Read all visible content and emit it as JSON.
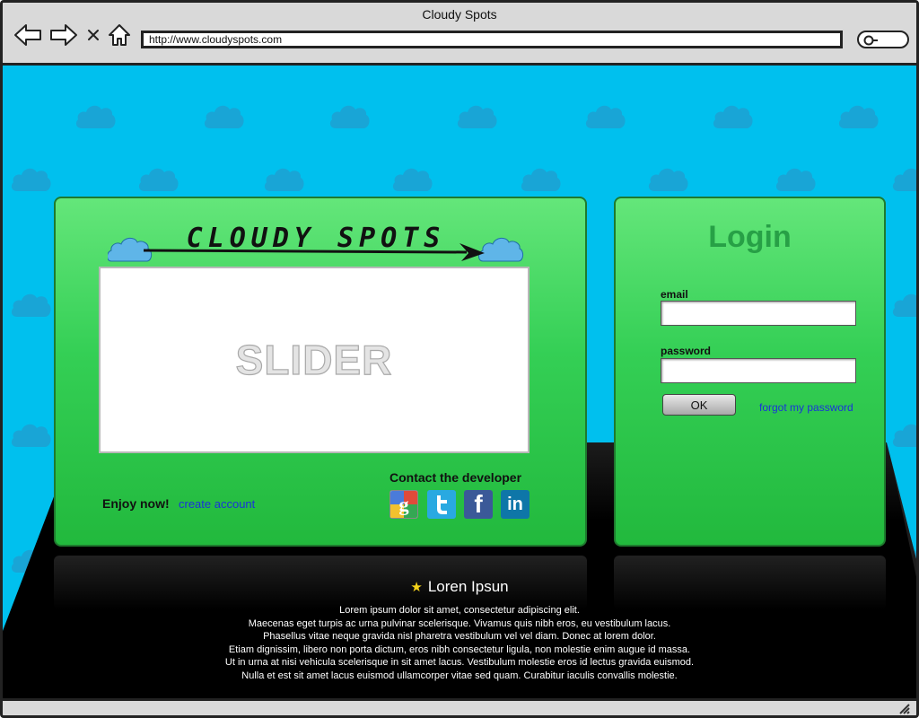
{
  "window": {
    "title": "Cloudy Spots",
    "url": "http://www.cloudyspots.com"
  },
  "icons": {
    "back": "arrow-left-icon",
    "forward": "arrow-right-icon",
    "stop": "close-icon",
    "home": "home-icon",
    "search": "search-icon",
    "resize": "resize-grip-icon"
  },
  "main": {
    "logo_text": "CLOUDY SPOTS",
    "slider_label": "SLIDER",
    "enjoy_text": "Enjoy now!",
    "create_account_link": "create account",
    "contact_title": "Contact the developer",
    "social": [
      {
        "name": "google",
        "icon": "google-icon"
      },
      {
        "name": "twitter",
        "icon": "twitter-icon"
      },
      {
        "name": "facebook",
        "icon": "facebook-icon",
        "glyph": "f"
      },
      {
        "name": "linkedin",
        "icon": "linkedin-icon",
        "glyph": "in"
      }
    ]
  },
  "login": {
    "title": "Login",
    "email_label": "email",
    "email_value": "",
    "password_label": "password",
    "password_value": "",
    "ok_label": "OK",
    "forgot_link": "forgot my password"
  },
  "footer": {
    "heading": "Loren Ipsun",
    "lines": [
      "Lorem ipsum dolor sit amet, consectetur adipiscing elit.",
      "Maecenas eget turpis ac urna pulvinar scelerisque. Vivamus quis nibh eros, eu vestibulum lacus.",
      "Phasellus vitae neque gravida nisl pharetra vestibulum vel vel diam. Donec at lorem dolor.",
      "Etiam dignissim, libero non porta dictum, eros nibh consectetur ligula, non molestie enim augue id massa.",
      "Ut in urna at nisi vehicula scelerisque in sit amet lacus. Vestibulum molestie eros id lectus gravida euismod.",
      "Nulla et est sit amet lacus euismod ullamcorper vitae sed quam. Curabitur iaculis convallis molestie."
    ]
  },
  "colors": {
    "sky": "#00c0ee",
    "panel_green": "#34cf55",
    "login_title": "#27a046",
    "link_blue": "#1a33d9",
    "stage_black": "#000000"
  }
}
